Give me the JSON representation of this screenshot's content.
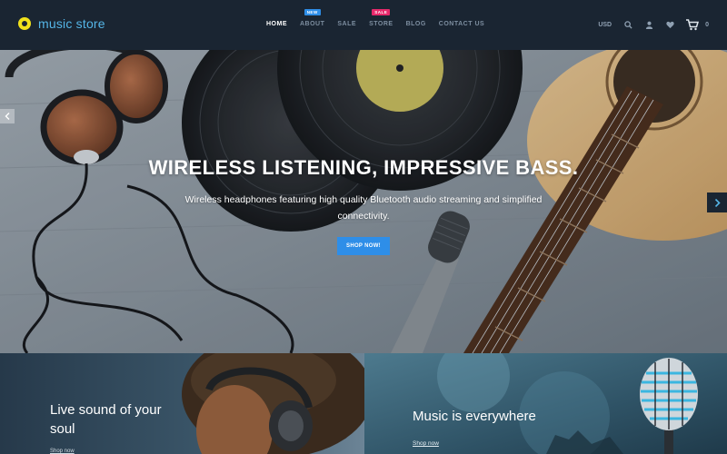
{
  "brand": {
    "name": "music store",
    "logo_color": "#f0e11b",
    "text_color": "#55b6e8"
  },
  "nav": {
    "items": [
      {
        "label": "HOME",
        "active": true
      },
      {
        "label": "ABOUT",
        "badge": "NEW"
      },
      {
        "label": "SALE"
      },
      {
        "label": "STORE",
        "badge": "SALE"
      },
      {
        "label": "BLOG"
      },
      {
        "label": "CONTACT US"
      }
    ]
  },
  "header_right": {
    "currency": "USD",
    "icons": [
      "search-icon",
      "user-icon",
      "heart-icon",
      "cart-icon"
    ],
    "cart_count": "0"
  },
  "hero": {
    "title": "WIRELESS LISTENING, IMPRESSIVE BASS.",
    "subtitle": "Wireless headphones featuring high quality Bluetooth audio streaming and simplified connectivity.",
    "button": "SHOP NOW!",
    "accent": "#2e8ee8"
  },
  "promos": [
    {
      "title": "Live sound of your soul",
      "link": "Shop now"
    },
    {
      "title": "Music is everywhere",
      "link": "Shop now"
    }
  ]
}
